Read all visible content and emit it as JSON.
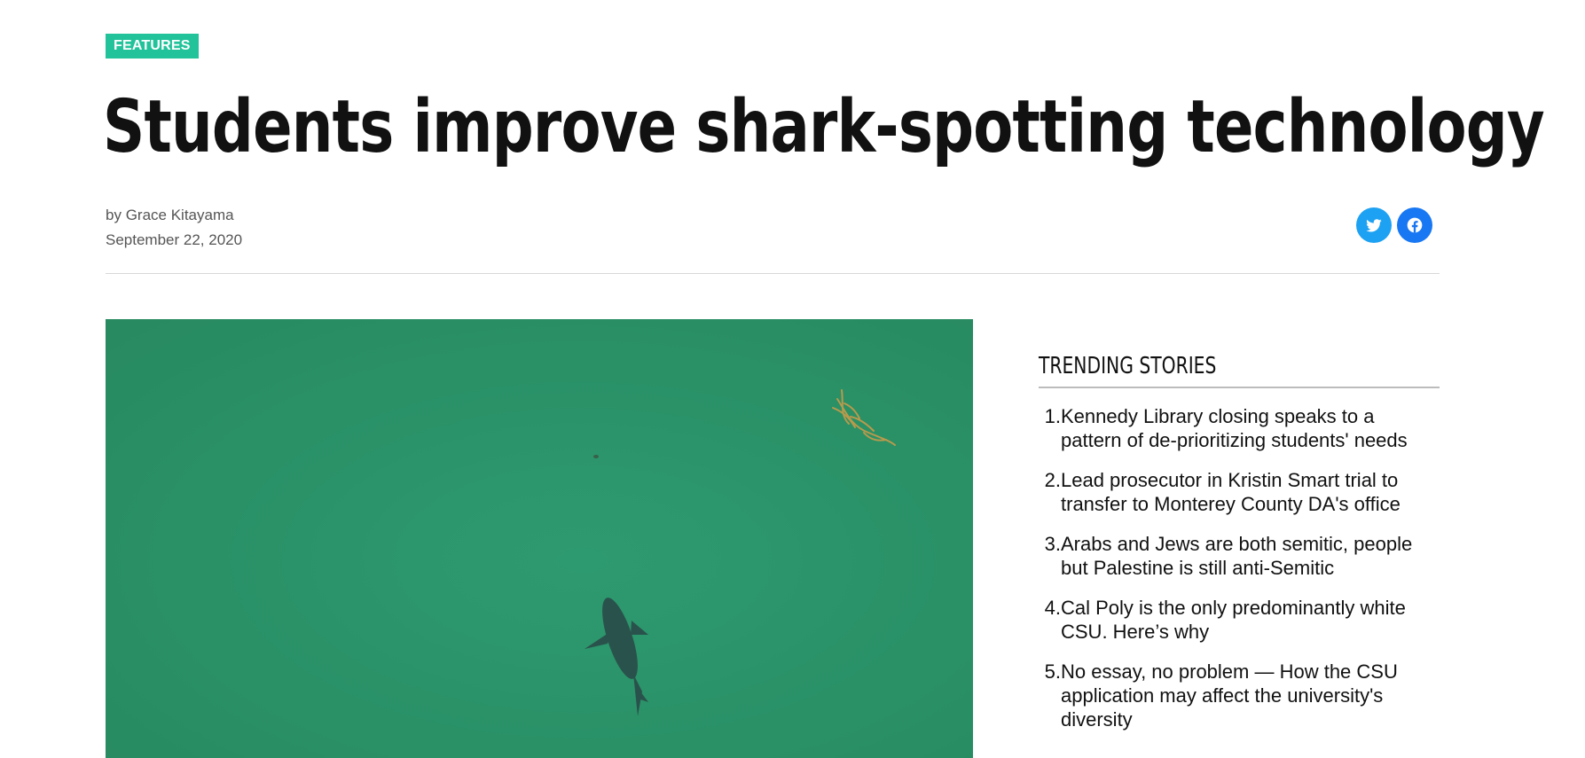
{
  "article": {
    "category": "FEATURES",
    "title": "Students improve shark-spotting technology",
    "byline_prefix": "by ",
    "author": "Grace Kitayama",
    "date": "September 22, 2020"
  },
  "share": {
    "twitter_icon": "twitter-icon",
    "facebook_icon": "facebook-icon",
    "twitter_color": "#1da1f2",
    "facebook_color": "#1877f2"
  },
  "colors": {
    "category_badge": "#22c39a",
    "hero_water": "#2c936c"
  },
  "trending": {
    "title": "TRENDING STORIES",
    "items": [
      {
        "number": "1.",
        "text": "Kennedy Library closing speaks to a pattern of de-prioritizing students' needs"
      },
      {
        "number": "2.",
        "text": "Lead prosecutor in Kristin Smart trial to transfer to Monterey County DA's office"
      },
      {
        "number": "3.",
        "text": "Arabs and Jews are both semitic, people but Palestine is still anti-Semitic"
      },
      {
        "number": "4.",
        "text": "Cal Poly is the only predominantly white CSU. Here’s why"
      },
      {
        "number": "5.",
        "text": "No essay, no problem — How the CSU application may affect the university's diversity"
      }
    ]
  }
}
